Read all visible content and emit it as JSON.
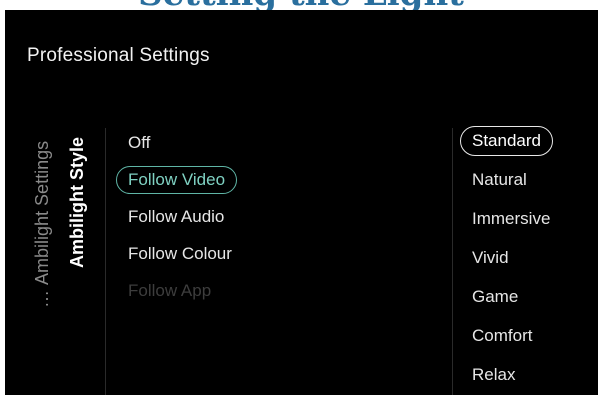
{
  "page_heading": "Setting the Light",
  "screen": {
    "title": "Professional Settings"
  },
  "breadcrumb": {
    "ellipsis": "…",
    "parent": "Ambilight Settings",
    "current": "Ambilight Style"
  },
  "ambilight_styles": {
    "items": [
      {
        "label": "Off",
        "state": "normal"
      },
      {
        "label": "Follow Video",
        "state": "selected"
      },
      {
        "label": "Follow Audio",
        "state": "normal"
      },
      {
        "label": "Follow Colour",
        "state": "normal"
      },
      {
        "label": "Follow App",
        "state": "disabled"
      }
    ]
  },
  "video_modes": {
    "items": [
      {
        "label": "Standard",
        "state": "selected"
      },
      {
        "label": "Natural",
        "state": "normal"
      },
      {
        "label": "Immersive",
        "state": "normal"
      },
      {
        "label": "Vivid",
        "state": "normal"
      },
      {
        "label": "Game",
        "state": "normal"
      },
      {
        "label": "Comfort",
        "state": "normal"
      },
      {
        "label": "Relax",
        "state": "normal"
      }
    ]
  },
  "colors": {
    "background": "#000000",
    "text": "#e6e6e6",
    "accent_selected": "#5fb5a6",
    "focus_outline": "#e8e8e8",
    "disabled_text": "#3d3d3d",
    "heading_blue": "#2a6f9e"
  }
}
